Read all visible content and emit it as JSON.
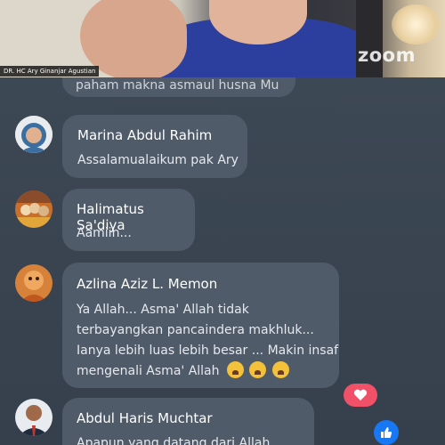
{
  "video": {
    "logo": "zoom",
    "speaker_name": "DR. HC Ary Ginanjar Agustian"
  },
  "chat": {
    "partial_message": "paham makna asmaul husna Mu",
    "comments": [
      {
        "author": "Marina Abdul Rahim",
        "message": "Assalamualaikum pak Ary"
      },
      {
        "author": "Halimatus Sa'diya",
        "message": "Aamiin..."
      },
      {
        "author": "Azlina Aziz L. Memon",
        "message_lines": [
          "Ya Allah... Asma' Allah tidak",
          "terbayangkan pancaindera makhluk...",
          "Ianya lebih luas lebih besar ... Makin insaf",
          "mengenali Asma' Allah"
        ],
        "emoji_count": 3,
        "emoji": "crying-face"
      },
      {
        "author": "Abdul Haris Muchtar",
        "message": "Apapun yang datang dari Allah"
      }
    ]
  },
  "reactions": [
    {
      "icon": "heart-icon",
      "color": "#f05068"
    },
    {
      "icon": "like-icon",
      "color": "#1877f2"
    }
  ]
}
